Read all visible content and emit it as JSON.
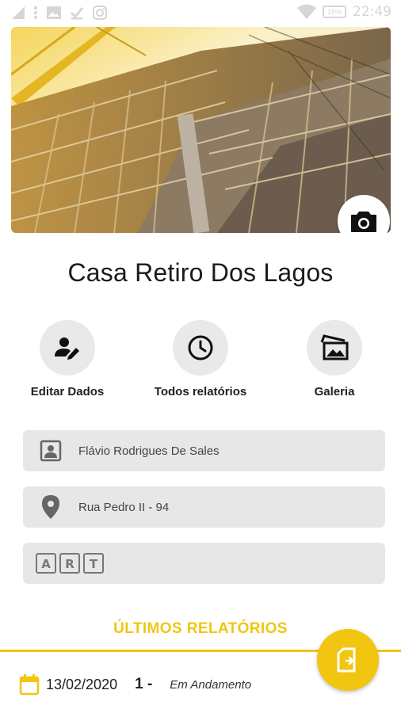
{
  "status_bar": {
    "time": "22:49",
    "battery": "16%"
  },
  "project": {
    "title": "Casa Retiro Dos Lagos"
  },
  "actions": [
    {
      "label": "Editar Dados",
      "icon": "edit-person-icon"
    },
    {
      "label": "Todos relatórios",
      "icon": "clock-icon"
    },
    {
      "label": "Galeria",
      "icon": "gallery-icon"
    }
  ],
  "fields": {
    "owner": "Flávio Rodrigues De Sales",
    "address": "Rua Pedro II - 94",
    "art": ""
  },
  "reports": {
    "section_title": "ÚLTIMOS RELATÓRIOS",
    "items": [
      {
        "date": "13/02/2020",
        "number": "1 -",
        "status": "Em Andamento"
      }
    ]
  },
  "colors": {
    "accent": "#f2c511",
    "field_bg": "#e7e7e7",
    "action_bg": "#e9e9ec"
  }
}
